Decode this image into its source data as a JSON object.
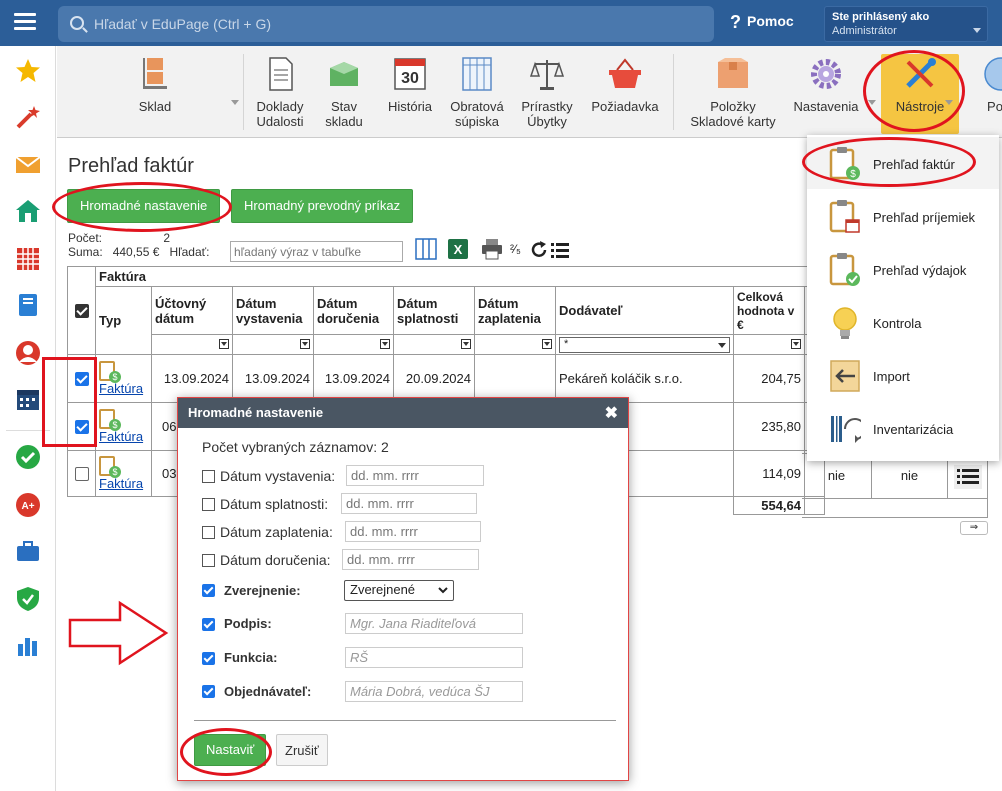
{
  "header": {
    "search_placeholder": "Hľadať v EduPage (Ctrl + G)",
    "help_label": "Pomoc",
    "user_line1": "Ste prihlásený ako",
    "user_line2": "Administrátor"
  },
  "toolbar": {
    "items": [
      {
        "label": "Sklad"
      },
      {
        "label": "Doklady\nUdalosti"
      },
      {
        "label": "Stav\nskladu"
      },
      {
        "label": "História",
        "badge": "30"
      },
      {
        "label": "Obratová\nsúpiska"
      },
      {
        "label": "Prírastky\nÚbytky"
      },
      {
        "label": "Požiadavka"
      },
      {
        "label": "Položky\nSkladové karty"
      },
      {
        "label": "Nastavenia"
      },
      {
        "label": "Nástroje"
      },
      {
        "label": "Po"
      }
    ]
  },
  "page": {
    "title": "Prehľad faktúr",
    "btn_bulk_settings": "Hromadné nastavenie",
    "btn_bulk_transfer": "Hromadný prevodný príkaz",
    "count_label": "Počet:",
    "count_value": "2",
    "sum_label": "Suma:",
    "sum_value": "440,55 €",
    "search_label": "Hľadať:",
    "search_placeholder": "hľadaný výraz v tabuľke",
    "fraction_icon": "²⁄₅"
  },
  "table": {
    "group_header": "Faktúra",
    "col_type": "Typ",
    "col_accounting": "Účtovný dátum",
    "col_issued": "Dátum vystavenia",
    "col_delivery": "Dátum doručenia",
    "col_due": "Dátum splatnosti",
    "col_paid": "Dátum zaplatenia",
    "col_supplier": "Dodávateľ",
    "col_total": "Celková hodnota v €",
    "supplier_filter": "*",
    "rows": [
      {
        "type": "Faktúra",
        "accounting": "13.09.2024",
        "issued": "13.09.2024",
        "delivery": "13.09.2024",
        "due": "20.09.2024",
        "paid": "",
        "supplier": "Pekáreň koláčik s.r.o.",
        "total": "204,75"
      },
      {
        "type": "Faktúra",
        "accounting": "06",
        "total": "235,80"
      },
      {
        "type": "Faktúra",
        "accounting": "03",
        "total": "114,09",
        "c1": "nie",
        "c2": "nie"
      }
    ],
    "sum_total": "554,64"
  },
  "menu": {
    "items": [
      {
        "label": "Prehľad faktúr"
      },
      {
        "label": "Prehľad príjemiek"
      },
      {
        "label": "Prehľad výdajok"
      },
      {
        "label": "Kontrola"
      },
      {
        "label": "Import"
      },
      {
        "label": "Inventarizácia"
      }
    ]
  },
  "modal": {
    "title": "Hromadné nastavenie",
    "count_text": "Počet vybraných záznamov: 2",
    "date_placeholder": "dd. mm. rrrr",
    "fields": [
      {
        "label": "Dátum vystavenia:"
      },
      {
        "label": "Dátum splatnosti:"
      },
      {
        "label": "Dátum zaplatenia:"
      },
      {
        "label": "Dátum doručenia:"
      }
    ],
    "publish_label": "Zverejnenie:",
    "publish_value": "Zverejnené",
    "signature_label": "Podpis:",
    "signature_placeholder": "Mgr. Jana Riaditeľová",
    "function_label": "Funkcia:",
    "function_placeholder": "RŠ",
    "orderer_label": "Objednávateľ:",
    "orderer_placeholder": "Mária Dobrá, vedúca ŠJ",
    "btn_apply": "Nastaviť",
    "btn_cancel": "Zrušiť"
  },
  "colors": {
    "header_bg": "#2c5e98",
    "green": "#4caf50",
    "annotation_red": "#e0141e",
    "checkbox_blue": "#1a73e8"
  }
}
